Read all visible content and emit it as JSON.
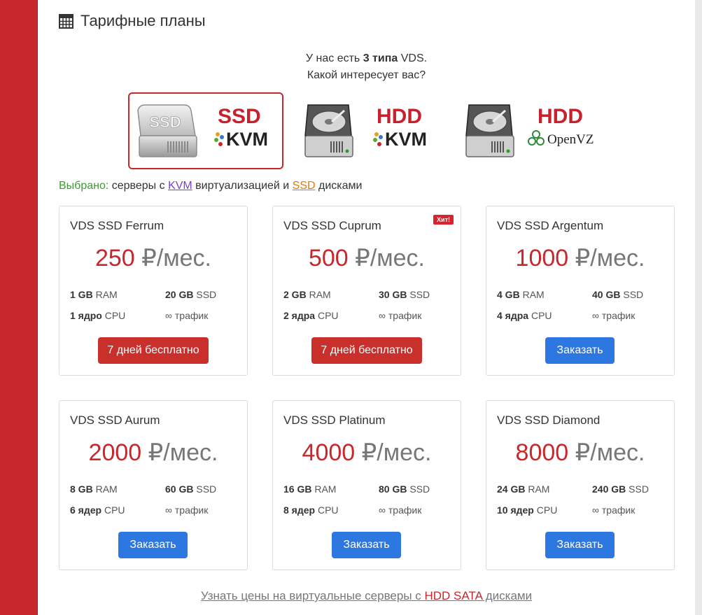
{
  "section": {
    "title": "Тарифные планы",
    "icon": "calculator-icon"
  },
  "intro": {
    "line1_before": "У нас есть ",
    "line1_bold": "3 типа",
    "line1_after": " VDS.",
    "line2": "Какой интересует вас?"
  },
  "server_types": [
    {
      "disk": "SSD",
      "virt": "KVM",
      "icon": "ssd-drive-icon",
      "selected": true
    },
    {
      "disk": "HDD",
      "virt": "KVM",
      "icon": "hdd-drive-icon",
      "selected": false
    },
    {
      "disk": "HDD",
      "virt": "OpenVZ",
      "icon": "hdd-drive-icon",
      "selected": false
    }
  ],
  "selection": {
    "label": "Выбрано:",
    "text1": " серверы с ",
    "virt_link": "KVM",
    "text2": " виртуализацией и ",
    "disk_link": "SSD",
    "text3": " дисками"
  },
  "plans": [
    {
      "name": "VDS SSD Ferrum",
      "price": "250",
      "currency": "₽",
      "period": "/мес.",
      "ram_val": "1 GB",
      "ram_unit": "RAM",
      "disk_val": "20 GB",
      "disk_unit": "SSD",
      "cpu_val": "1 ядро",
      "cpu_unit": "CPU",
      "traffic": "∞ трафик",
      "button": "7 дней бесплатно",
      "button_style": "red",
      "badge": ""
    },
    {
      "name": "VDS SSD Cuprum",
      "price": "500",
      "currency": "₽",
      "period": "/мес.",
      "ram_val": "2 GB",
      "ram_unit": "RAM",
      "disk_val": "30 GB",
      "disk_unit": "SSD",
      "cpu_val": "2 ядра",
      "cpu_unit": "CPU",
      "traffic": "∞ трафик",
      "button": "7 дней бесплатно",
      "button_style": "red",
      "badge": "Хит!"
    },
    {
      "name": "VDS SSD Argentum",
      "price": "1000",
      "currency": "₽",
      "period": "/мес.",
      "ram_val": "4 GB",
      "ram_unit": "RAM",
      "disk_val": "40 GB",
      "disk_unit": "SSD",
      "cpu_val": "4 ядра",
      "cpu_unit": "CPU",
      "traffic": "∞ трафик",
      "button": "Заказать",
      "button_style": "blue",
      "badge": ""
    },
    {
      "name": "VDS SSD Aurum",
      "price": "2000",
      "currency": "₽",
      "period": "/мес.",
      "ram_val": "8 GB",
      "ram_unit": "RAM",
      "disk_val": "60 GB",
      "disk_unit": "SSD",
      "cpu_val": "6 ядер",
      "cpu_unit": "CPU",
      "traffic": "∞ трафик",
      "button": "Заказать",
      "button_style": "blue",
      "badge": ""
    },
    {
      "name": "VDS SSD Platinum",
      "price": "4000",
      "currency": "₽",
      "period": "/мес.",
      "ram_val": "16 GB",
      "ram_unit": "RAM",
      "disk_val": "80 GB",
      "disk_unit": "SSD",
      "cpu_val": "8 ядер",
      "cpu_unit": "CPU",
      "traffic": "∞ трафик",
      "button": "Заказать",
      "button_style": "blue",
      "badge": ""
    },
    {
      "name": "VDS SSD Diamond",
      "price": "8000",
      "currency": "₽",
      "period": "/мес.",
      "ram_val": "24 GB",
      "ram_unit": "RAM",
      "disk_val": "240 GB",
      "disk_unit": "SSD",
      "cpu_val": "10 ядер",
      "cpu_unit": "CPU",
      "traffic": "∞ трафик",
      "button": "Заказать",
      "button_style": "blue",
      "badge": ""
    }
  ],
  "footer": {
    "before": "Узнать цены на виртуальные серверы с ",
    "highlight": "HDD SATA",
    "after": " дисками"
  },
  "colors": {
    "accent_red": "#c8272c",
    "button_red": "#c9302c",
    "button_blue": "#2d78e0",
    "selected_label_green": "#3a9e2e",
    "kvm_link": "#7b3fd0",
    "ssd_link": "#e07a10"
  }
}
